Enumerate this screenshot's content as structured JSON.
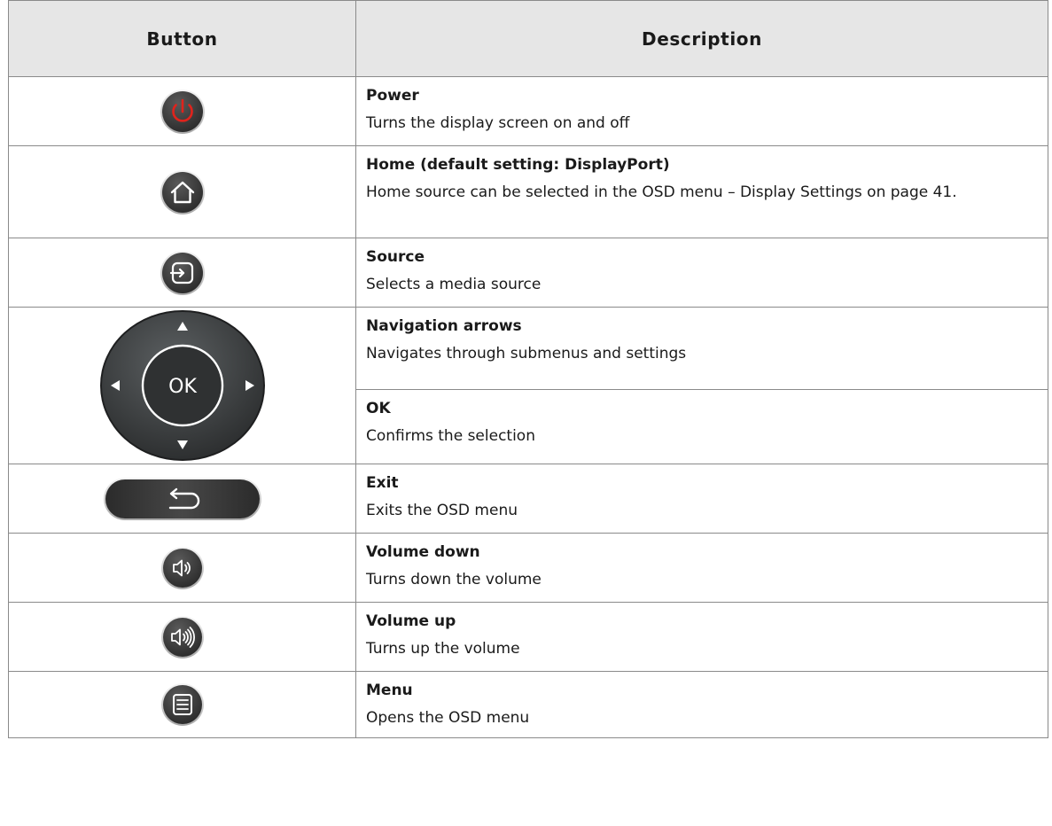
{
  "header": {
    "button": "Button",
    "description": "Description"
  },
  "rows": [
    {
      "icon": "power-icon",
      "title": "Power",
      "text": "Turns the display screen on and off"
    },
    {
      "icon": "home-icon",
      "title": "Home (default setting: DisplayPort)",
      "text": "Home source can be selected in the OSD menu – Display Settings on page 41."
    },
    {
      "icon": "source-icon",
      "title": "Source",
      "text": "Selects a media source"
    },
    {
      "icon": "navigation-pad-icon",
      "title": "Navigation arrows",
      "text": "Navigates through submenus and settings"
    },
    {
      "icon": "ok-icon",
      "title": "OK",
      "text": "Confirms the selection"
    },
    {
      "icon": "exit-return-icon",
      "title": "Exit",
      "text": "Exits the OSD menu"
    },
    {
      "icon": "volume-down-icon",
      "title": "Volume down",
      "text": "Turns down the volume"
    },
    {
      "icon": "volume-up-icon",
      "title": "Volume up",
      "text": "Turns up the volume"
    },
    {
      "icon": "menu-list-icon",
      "title": "Menu",
      "text": "Opens the OSD menu"
    }
  ],
  "nav_pad": {
    "ok_label": "OK"
  },
  "colors": {
    "button_dark": "#3a3a3a",
    "power_red": "#e0231c",
    "header_bg": "#e6e6e6"
  }
}
